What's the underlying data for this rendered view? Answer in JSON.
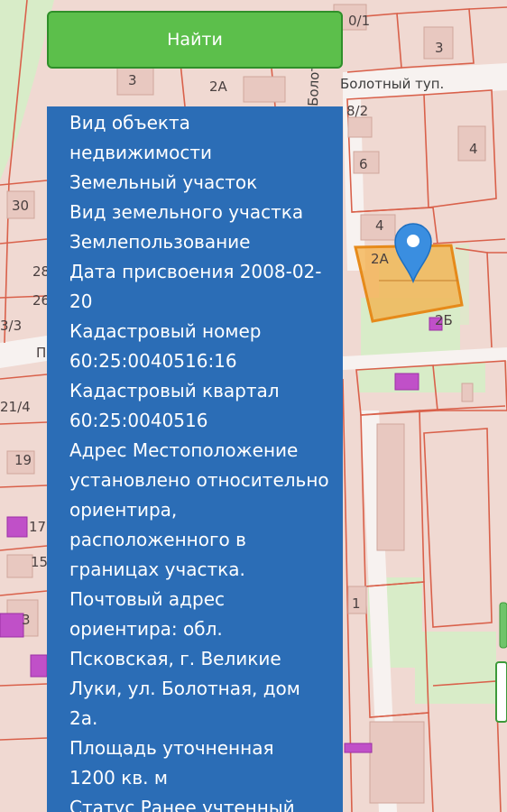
{
  "search": {
    "button_label": "Найти"
  },
  "map": {
    "street_name": "Болотный туп.",
    "vertical_street": "Болот",
    "house_labels": {
      "a": "3",
      "b": "2А",
      "c": "0/1",
      "d": "3",
      "e": "8/2",
      "f": "4",
      "g": "6",
      "h": "30",
      "i": "4",
      "j": "2А",
      "k": "2Б",
      "l": "28",
      "m": "26",
      "n": "3/3",
      "o": "21/4",
      "p": "19",
      "q": "17",
      "r": "15",
      "s": "3",
      "t": "1",
      "u": "П"
    },
    "colors": {
      "background": "#f0d9d2",
      "parcel_border": "#d9614b",
      "building": "#e8c8c0",
      "green": "#d8ecc8",
      "purple_building": "#c050c8",
      "selected_parcel_fill": "#f4b04a",
      "selected_parcel_border": "#e68a1a",
      "marker": "#3a8ee0"
    }
  },
  "info_panel": {
    "color": "#2b6db6",
    "object_kind_label": "Вид объекта недвижимости",
    "object_kind_value": "Земельный участок",
    "parcel_kind_label": "Вид земельного участка",
    "parcel_kind_value": "Землепользование",
    "assigned_date_label": "Дата присвоения",
    "assigned_date_value": "2008-02-20",
    "cadastral_number_label": "Кадастровый номер",
    "cadastral_number_value": "60:25:0040516:16",
    "cadastral_block_label": "Кадастровый квартал",
    "cadastral_block_value": "60:25:0040516",
    "address_label": "Адрес",
    "address_value": "Местоположение установлено относительно ориентира, расположенного в границах участка. Почтовый адрес ориентира: обл. Псковская, г. Великие Луки, ул. Болотная, дом 2а.",
    "area_label": "Площадь уточненная",
    "area_value": "1200 кв. м",
    "status_label": "Статус",
    "status_value": "Ранее учтенный"
  }
}
